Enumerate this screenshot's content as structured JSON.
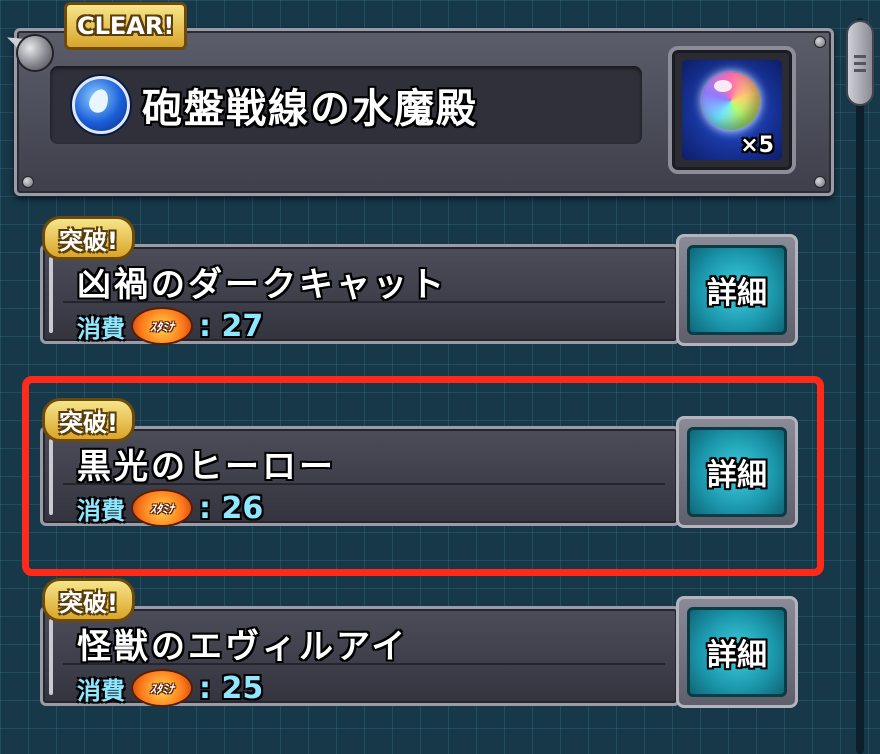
{
  "header": {
    "clear_badge": "CLEAR!",
    "stage_title": "砲盤戦線の水魔殿",
    "element_icon": "water-element-icon",
    "reward": {
      "icon": "rainbow-orb-icon",
      "count": "×5"
    }
  },
  "quests": [
    {
      "badge": "突破!",
      "name": "凶禍のダークキャット",
      "cost_label": "消費",
      "stamina_icon_text": "ｽﾀﾐﾅ",
      "cost_value": ": 27",
      "detail_label": "詳細"
    },
    {
      "badge": "突破!",
      "name": "黒光のヒーロー",
      "cost_label": "消費",
      "stamina_icon_text": "ｽﾀﾐﾅ",
      "cost_value": ": 26",
      "detail_label": "詳細"
    },
    {
      "badge": "突破!",
      "name": "怪獣のエヴィルアイ",
      "cost_label": "消費",
      "stamina_icon_text": "ｽﾀﾐﾅ",
      "cost_value": ": 25",
      "detail_label": "詳細"
    }
  ],
  "colors": {
    "highlight": "#ff2a1a",
    "cost_text": "#8fe6ff",
    "badge_gold": "#d9a52a",
    "detail_teal": "#1b96ab"
  }
}
